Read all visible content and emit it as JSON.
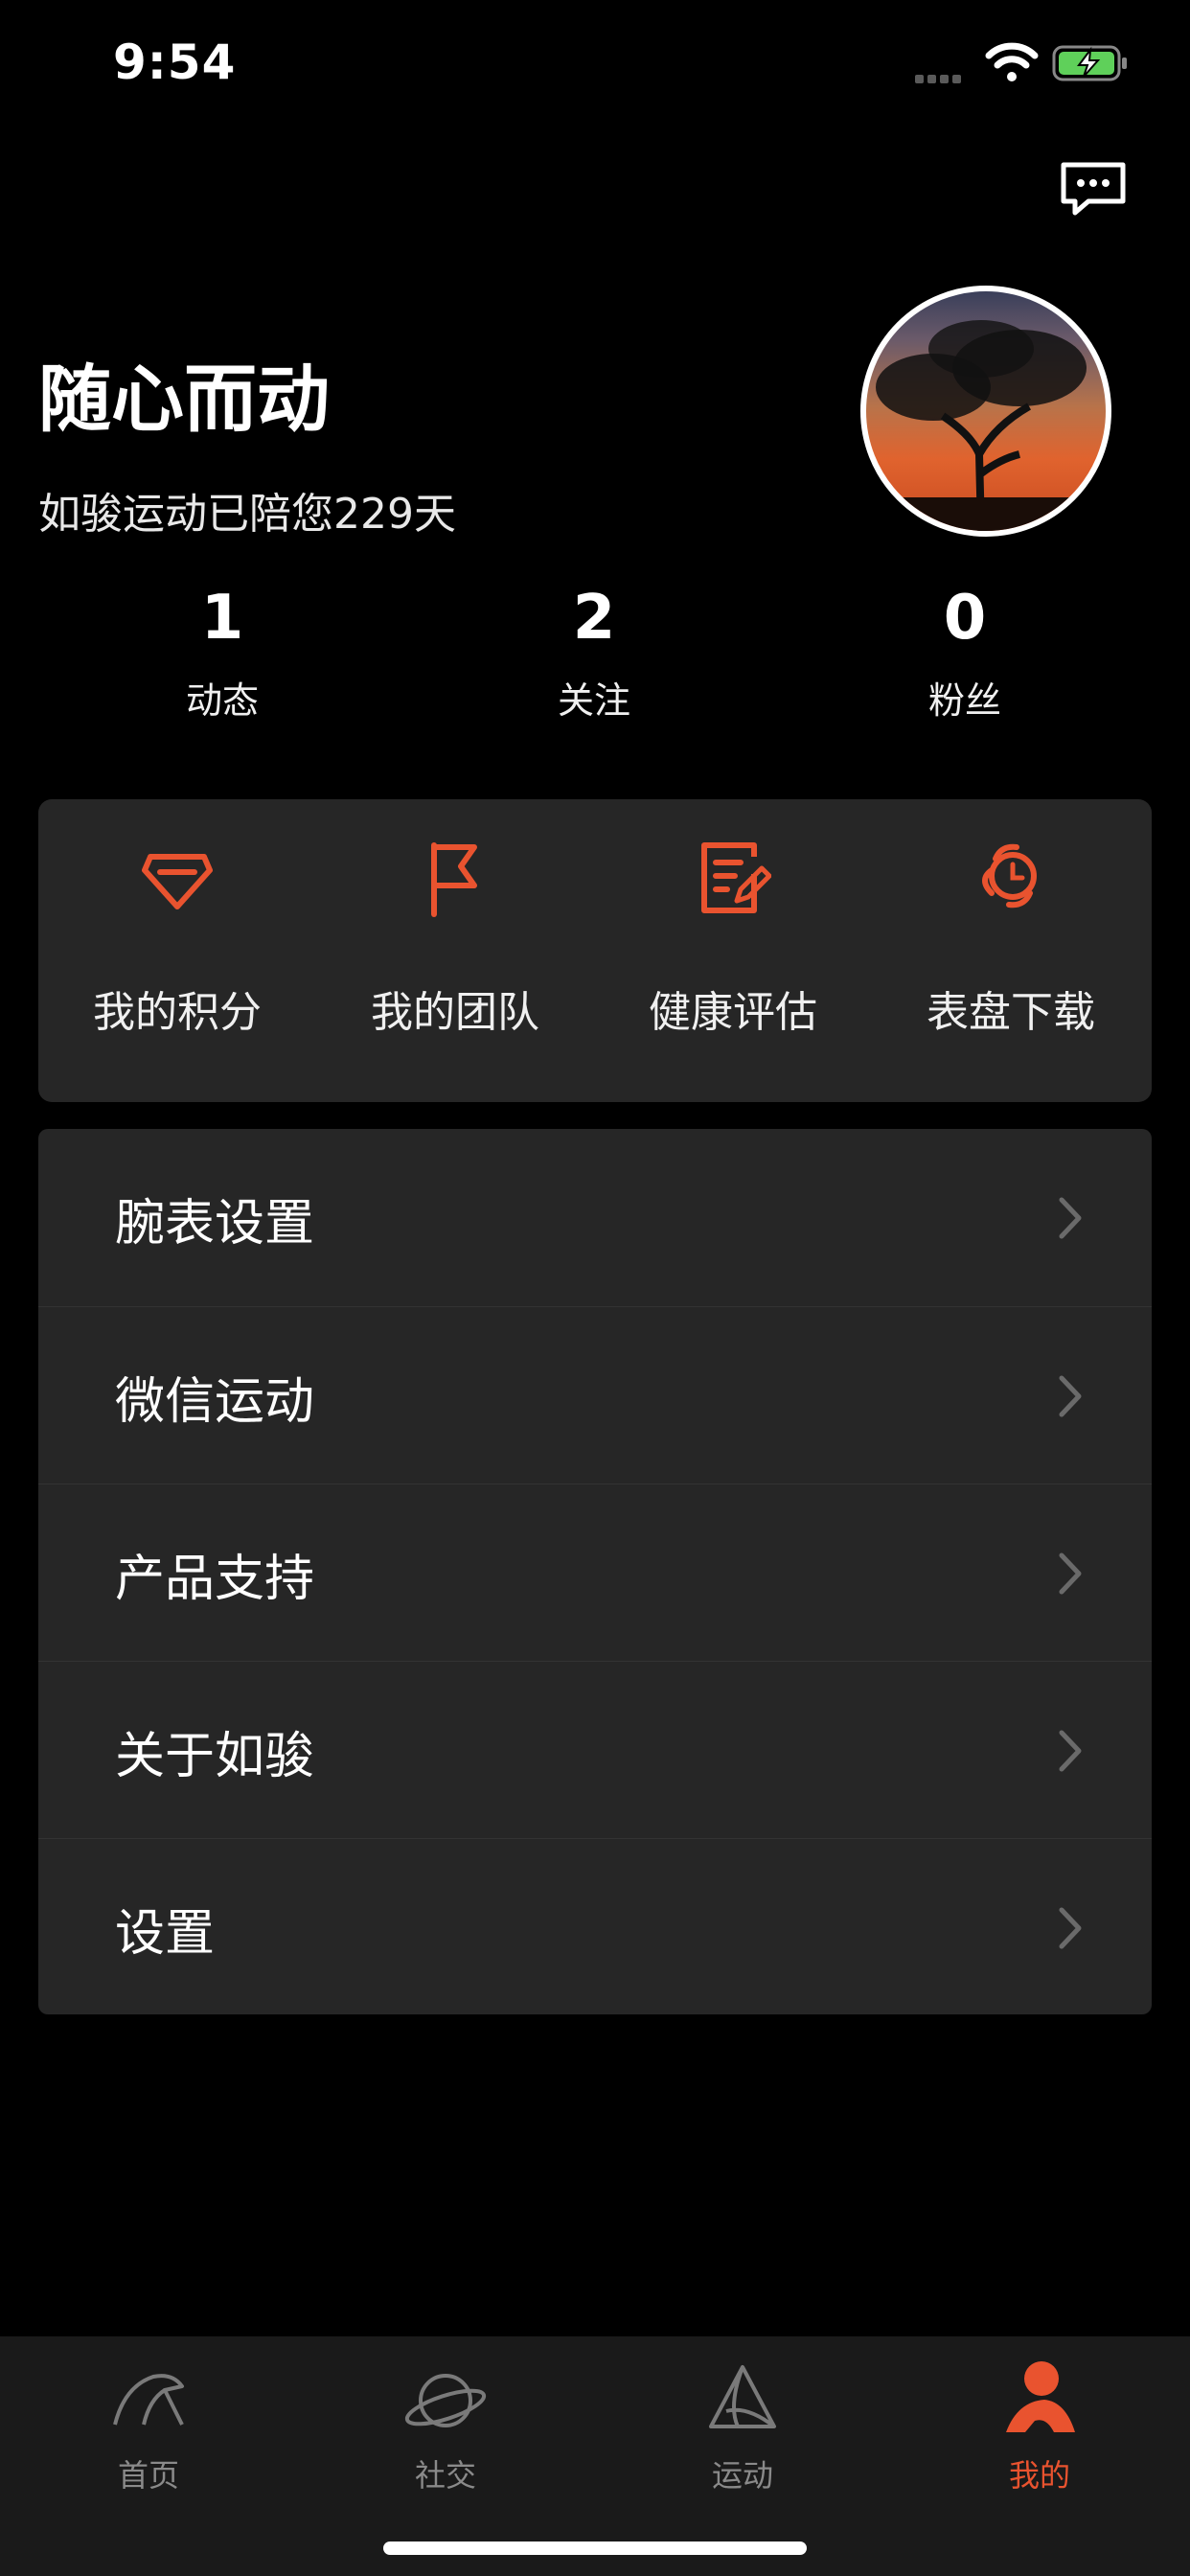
{
  "status_bar": {
    "time": "9:54"
  },
  "header": {
    "message_icon": "chat-bubble-icon"
  },
  "profile": {
    "username": "随心而动",
    "companion_text": "如骏运动已陪您229天",
    "stats": [
      {
        "value": "1",
        "label": "动态"
      },
      {
        "value": "2",
        "label": "关注"
      },
      {
        "value": "0",
        "label": "粉丝"
      }
    ]
  },
  "quick_actions": [
    {
      "label": "我的积分",
      "icon": "diamond-icon"
    },
    {
      "label": "我的团队",
      "icon": "flag-icon"
    },
    {
      "label": "健康评估",
      "icon": "edit-report-icon"
    },
    {
      "label": "表盘下载",
      "icon": "watch-icon"
    }
  ],
  "menu": [
    {
      "label": "腕表设置"
    },
    {
      "label": "微信运动"
    },
    {
      "label": "产品支持"
    },
    {
      "label": "关于如骏"
    },
    {
      "label": "设置"
    }
  ],
  "tabbar": {
    "tabs": [
      {
        "label": "首页",
        "icon": "home-icon",
        "active": false
      },
      {
        "label": "社交",
        "icon": "planet-icon",
        "active": false
      },
      {
        "label": "运动",
        "icon": "sport-icon",
        "active": false
      },
      {
        "label": "我的",
        "icon": "person-icon",
        "active": true
      }
    ]
  },
  "colors": {
    "accent": "#e9532f",
    "background": "#000000",
    "card": "#262626"
  }
}
